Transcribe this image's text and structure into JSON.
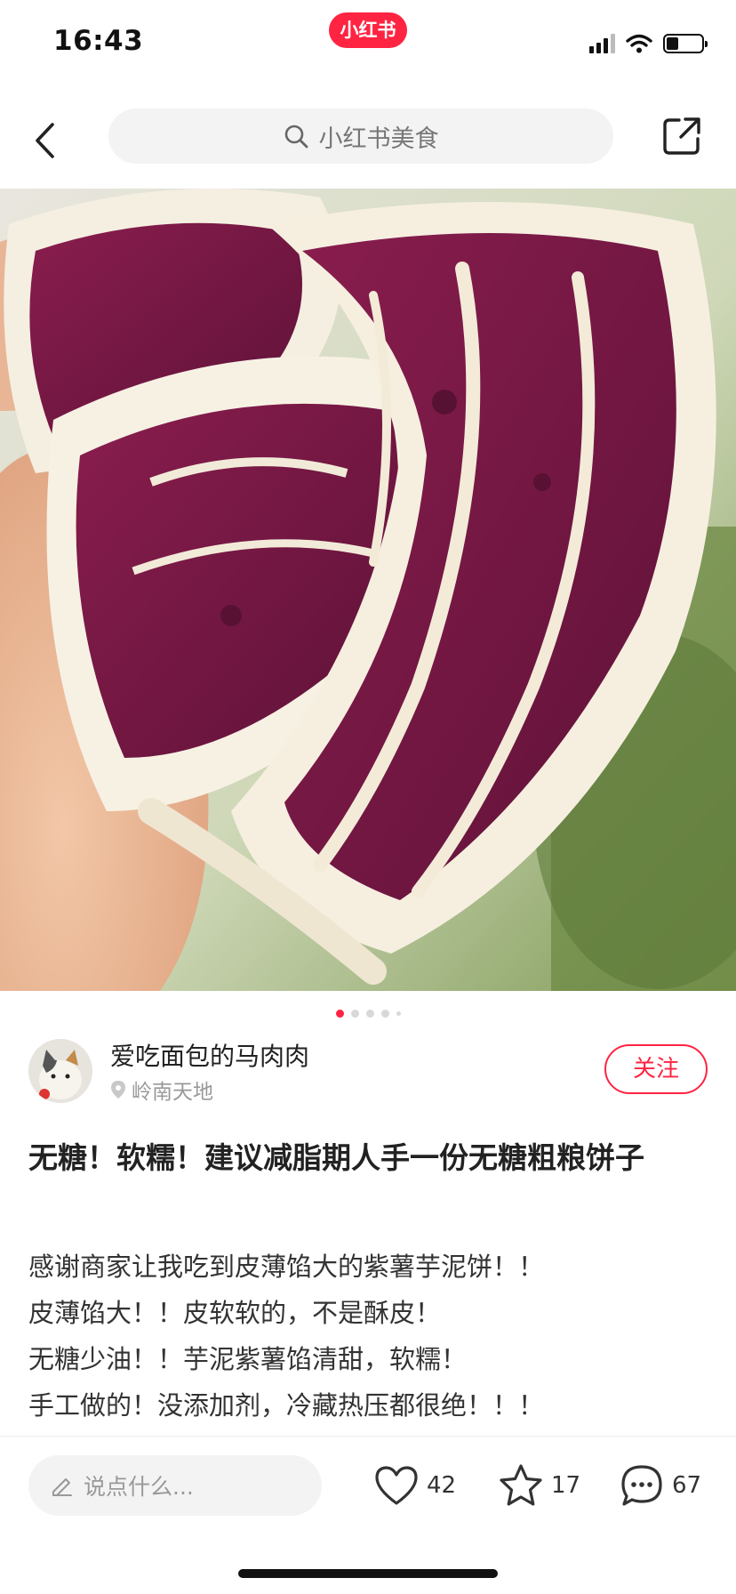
{
  "status_bar": {
    "time": "16:43",
    "app_badge": "小红书",
    "battery_level": 0.35,
    "icons": [
      "cellular-signal-icon",
      "wifi-icon",
      "battery-icon"
    ]
  },
  "nav": {
    "back_icon": "chevron-left-icon",
    "search_icon": "search-icon",
    "search_placeholder": "小红书美食",
    "share_icon": "share-icon"
  },
  "gallery": {
    "image_count": 5,
    "current_index": 1,
    "active_dot_color": "#ff2442"
  },
  "author": {
    "name": "爱吃面包的马肉肉",
    "location": "岭南天地",
    "follow_label": "关注"
  },
  "post": {
    "title": "无糖！软糯！建议减脂期人手一份无糖粗粮饼子",
    "body_lines": [
      "感谢商家让我吃到皮薄馅大的紫薯芋泥饼！！",
      "皮薄馅大！！皮软软的，不是酥皮！",
      "无糖少油！！芋泥紫薯馅清甜，软糯！",
      "手工做的！没添加剂，冷藏热压都很绝！！！"
    ]
  },
  "bottom_bar": {
    "comment_placeholder": "说点什么...",
    "like_count": "42",
    "collect_count": "17",
    "comment_count": "67"
  },
  "colors": {
    "brand": "#ff2442",
    "muted_text": "#999999"
  }
}
